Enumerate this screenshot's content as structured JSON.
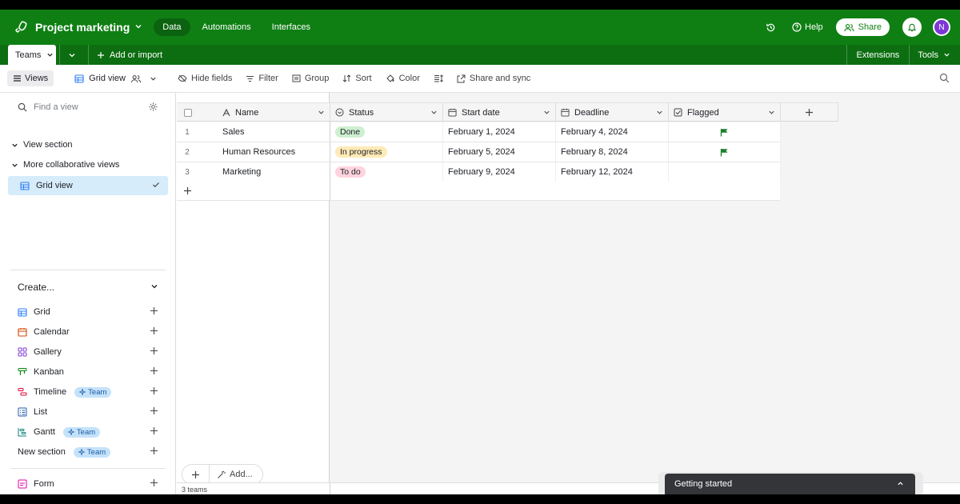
{
  "appbar": {
    "base_title": "Project marketing",
    "nav": [
      "Data",
      "Automations",
      "Interfaces"
    ],
    "help": "Help",
    "share": "Share",
    "avatar_initial": "N",
    "brand_color": "#0f7f14"
  },
  "tabbar": {
    "active_table": "Teams",
    "add_import": "Add or import",
    "extensions": "Extensions",
    "tools": "Tools"
  },
  "viewbar": {
    "views": "Views",
    "current_view": "Grid view",
    "hide_fields": "Hide fields",
    "filter": "Filter",
    "group": "Group",
    "sort": "Sort",
    "color": "Color",
    "share_sync": "Share and sync"
  },
  "sidebar": {
    "find_placeholder": "Find a view",
    "section1": "View section",
    "section2": "More collaborative views",
    "selected_view": "Grid view",
    "create_header": "Create...",
    "create_items": [
      {
        "label": "Grid",
        "icon": "grid-icon",
        "badge": ""
      },
      {
        "label": "Calendar",
        "icon": "calendar-icon",
        "badge": ""
      },
      {
        "label": "Gallery",
        "icon": "gallery-icon",
        "badge": ""
      },
      {
        "label": "Kanban",
        "icon": "kanban-icon",
        "badge": ""
      },
      {
        "label": "Timeline",
        "icon": "timeline-icon",
        "badge": "Team"
      },
      {
        "label": "List",
        "icon": "list-icon",
        "badge": ""
      },
      {
        "label": "Gantt",
        "icon": "gantt-icon",
        "badge": "Team"
      },
      {
        "label": "New section",
        "icon": "",
        "badge": "Team"
      },
      {
        "label": "Form",
        "icon": "form-icon",
        "badge": ""
      }
    ]
  },
  "grid": {
    "columns": [
      "Name",
      "Status",
      "Start date",
      "Deadline",
      "Flagged"
    ],
    "rows": [
      {
        "num": "1",
        "name": "Sales",
        "status": "Done",
        "start": "February 1, 2024",
        "deadline": "February 4, 2024",
        "flagged": true
      },
      {
        "num": "2",
        "name": "Human Resources",
        "status": "In progress",
        "start": "February 5, 2024",
        "deadline": "February 8, 2024",
        "flagged": true
      },
      {
        "num": "3",
        "name": "Marketing",
        "status": "To do",
        "start": "February 9, 2024",
        "deadline": "February 12, 2024",
        "flagged": false
      }
    ],
    "footer_count": "3 teams",
    "add_label": "Add..."
  },
  "getting_started": "Getting started"
}
